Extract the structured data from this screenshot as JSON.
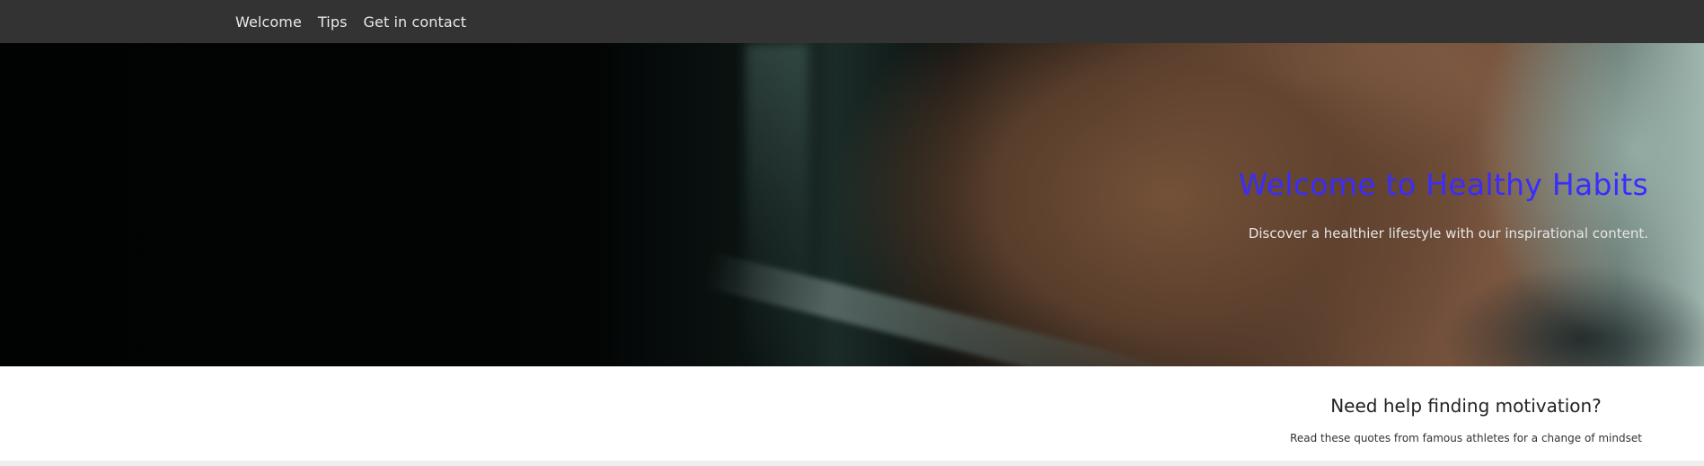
{
  "nav": {
    "items": [
      {
        "label": "Welcome"
      },
      {
        "label": "Tips"
      },
      {
        "label": "Get in contact"
      }
    ]
  },
  "hero": {
    "title": "Welcome to Healthy Habits",
    "subtitle": "Discover a healthier lifestyle with our inspirational content.",
    "title_color": "#3a2cff"
  },
  "motivation": {
    "title": "Need help finding motivation?",
    "text": "Read these quotes from famous athletes for a change of mindset"
  }
}
